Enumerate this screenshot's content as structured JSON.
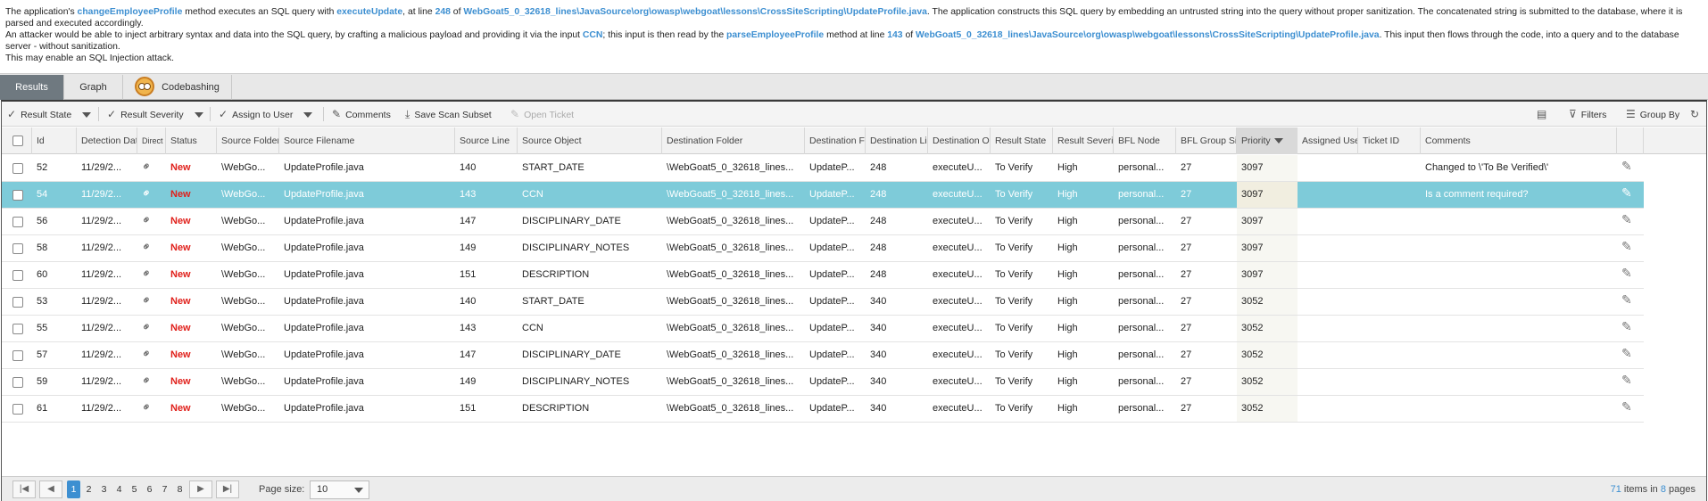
{
  "description": {
    "l1_a": "The application's ",
    "l1_b": "changeEmployeeProfile",
    "l1_c": " method executes an SQL query with ",
    "l1_d": "executeUpdate",
    "l1_e": ", at line ",
    "l1_f": "248",
    "l1_g": " of ",
    "l1_h": "WebGoat5_0_32618_lines\\JavaSource\\org\\owasp\\webgoat\\lessons\\CrossSiteScripting\\UpdateProfile.java",
    "l1_i": ". The application constructs this SQL query by embedding an untrusted string into the query without proper sanitization. The concatenated string is submitted to the database, where it is parsed and executed accordingly.",
    "l2_a": "An attacker would be able to inject arbitrary syntax and data into the SQL query, by crafting a malicious payload and providing it via the input ",
    "l2_b": "CCN",
    "l2_c": "; this input is then read by the ",
    "l2_d": "parseEmployeeProfile",
    "l2_e": " method at line ",
    "l2_f": "143",
    "l2_g": " of ",
    "l2_h": "WebGoat5_0_32618_lines\\JavaSource\\org\\owasp\\webgoat\\lessons\\CrossSiteScripting\\UpdateProfile.java",
    "l2_i": ". This input then flows through the code, into a query and to the database server - without sanitization.",
    "l3": "This may enable an SQL Injection attack."
  },
  "tabs": [
    {
      "label": "Results",
      "active": true
    },
    {
      "label": "Graph",
      "active": false
    },
    {
      "label": "Codebashing",
      "active": false
    }
  ],
  "toolbar": {
    "result_state": "Result State",
    "result_severity": "Result Severity",
    "assign_to_user": "Assign to User",
    "comments": "Comments",
    "save_scan_subset": "Save Scan Subset",
    "open_ticket": "Open Ticket",
    "filters": "Filters",
    "group_by": "Group By"
  },
  "columns": [
    "Id",
    "Detection Date",
    "Direct",
    "Status",
    "Source Folder",
    "Source Filename",
    "Source Line",
    "Source Object",
    "Destination Folder",
    "Destination Fi",
    "Destination Li",
    "Destination Ob",
    "Result State",
    "Result Severity",
    "BFL Node",
    "BFL Group Siz",
    "Priority",
    "Assigned User",
    "Ticket ID",
    "Comments"
  ],
  "rows": [
    {
      "id": "52",
      "date": "11/29/2...",
      "status": "New",
      "src_folder": "\\WebGo...",
      "src_file": "UpdateProfile.java",
      "src_line": "140",
      "src_obj": "START_DATE",
      "dst_folder": "\\WebGoat5_0_32618_lines...",
      "dst_file": "UpdateP...",
      "dst_line": "248",
      "dst_obj": "executeU...",
      "res_state": "To Verify",
      "severity": "High",
      "bfl_node": "personal...",
      "bfl_group": "27",
      "priority": "3097",
      "comment": "Changed to \\'To Be Verified\\'"
    },
    {
      "id": "54",
      "date": "11/29/2...",
      "status": "New",
      "src_folder": "\\WebGo...",
      "src_file": "UpdateProfile.java",
      "src_line": "143",
      "src_obj": "CCN",
      "dst_folder": "\\WebGoat5_0_32618_lines...",
      "dst_file": "UpdateP...",
      "dst_line": "248",
      "dst_obj": "executeU...",
      "res_state": "To Verify",
      "severity": "High",
      "bfl_node": "personal...",
      "bfl_group": "27",
      "priority": "3097",
      "comment": "Is a comment required?"
    },
    {
      "id": "56",
      "date": "11/29/2...",
      "status": "New",
      "src_folder": "\\WebGo...",
      "src_file": "UpdateProfile.java",
      "src_line": "147",
      "src_obj": "DISCIPLINARY_DATE",
      "dst_folder": "\\WebGoat5_0_32618_lines...",
      "dst_file": "UpdateP...",
      "dst_line": "248",
      "dst_obj": "executeU...",
      "res_state": "To Verify",
      "severity": "High",
      "bfl_node": "personal...",
      "bfl_group": "27",
      "priority": "3097",
      "comment": ""
    },
    {
      "id": "58",
      "date": "11/29/2...",
      "status": "New",
      "src_folder": "\\WebGo...",
      "src_file": "UpdateProfile.java",
      "src_line": "149",
      "src_obj": "DISCIPLINARY_NOTES",
      "dst_folder": "\\WebGoat5_0_32618_lines...",
      "dst_file": "UpdateP...",
      "dst_line": "248",
      "dst_obj": "executeU...",
      "res_state": "To Verify",
      "severity": "High",
      "bfl_node": "personal...",
      "bfl_group": "27",
      "priority": "3097",
      "comment": ""
    },
    {
      "id": "60",
      "date": "11/29/2...",
      "status": "New",
      "src_folder": "\\WebGo...",
      "src_file": "UpdateProfile.java",
      "src_line": "151",
      "src_obj": "DESCRIPTION",
      "dst_folder": "\\WebGoat5_0_32618_lines...",
      "dst_file": "UpdateP...",
      "dst_line": "248",
      "dst_obj": "executeU...",
      "res_state": "To Verify",
      "severity": "High",
      "bfl_node": "personal...",
      "bfl_group": "27",
      "priority": "3097",
      "comment": ""
    },
    {
      "id": "53",
      "date": "11/29/2...",
      "status": "New",
      "src_folder": "\\WebGo...",
      "src_file": "UpdateProfile.java",
      "src_line": "140",
      "src_obj": "START_DATE",
      "dst_folder": "\\WebGoat5_0_32618_lines...",
      "dst_file": "UpdateP...",
      "dst_line": "340",
      "dst_obj": "executeU...",
      "res_state": "To Verify",
      "severity": "High",
      "bfl_node": "personal...",
      "bfl_group": "27",
      "priority": "3052",
      "comment": ""
    },
    {
      "id": "55",
      "date": "11/29/2...",
      "status": "New",
      "src_folder": "\\WebGo...",
      "src_file": "UpdateProfile.java",
      "src_line": "143",
      "src_obj": "CCN",
      "dst_folder": "\\WebGoat5_0_32618_lines...",
      "dst_file": "UpdateP...",
      "dst_line": "340",
      "dst_obj": "executeU...",
      "res_state": "To Verify",
      "severity": "High",
      "bfl_node": "personal...",
      "bfl_group": "27",
      "priority": "3052",
      "comment": ""
    },
    {
      "id": "57",
      "date": "11/29/2...",
      "status": "New",
      "src_folder": "\\WebGo...",
      "src_file": "UpdateProfile.java",
      "src_line": "147",
      "src_obj": "DISCIPLINARY_DATE",
      "dst_folder": "\\WebGoat5_0_32618_lines...",
      "dst_file": "UpdateP...",
      "dst_line": "340",
      "dst_obj": "executeU...",
      "res_state": "To Verify",
      "severity": "High",
      "bfl_node": "personal...",
      "bfl_group": "27",
      "priority": "3052",
      "comment": ""
    },
    {
      "id": "59",
      "date": "11/29/2...",
      "status": "New",
      "src_folder": "\\WebGo...",
      "src_file": "UpdateProfile.java",
      "src_line": "149",
      "src_obj": "DISCIPLINARY_NOTES",
      "dst_folder": "\\WebGoat5_0_32618_lines...",
      "dst_file": "UpdateP...",
      "dst_line": "340",
      "dst_obj": "executeU...",
      "res_state": "To Verify",
      "severity": "High",
      "bfl_node": "personal...",
      "bfl_group": "27",
      "priority": "3052",
      "comment": ""
    },
    {
      "id": "61",
      "date": "11/29/2...",
      "status": "New",
      "src_folder": "\\WebGo...",
      "src_file": "UpdateProfile.java",
      "src_line": "151",
      "src_obj": "DESCRIPTION",
      "dst_folder": "\\WebGoat5_0_32618_lines...",
      "dst_file": "UpdateP...",
      "dst_line": "340",
      "dst_obj": "executeU...",
      "res_state": "To Verify",
      "severity": "High",
      "bfl_node": "personal...",
      "bfl_group": "27",
      "priority": "3052",
      "comment": ""
    }
  ],
  "selected_row_index": 1,
  "pager": {
    "pages": [
      "1",
      "2",
      "3",
      "4",
      "5",
      "6",
      "7",
      "8"
    ],
    "current": "1",
    "page_size_label": "Page size:",
    "page_size": "10",
    "total_items": "71",
    "items_in": " items in ",
    "total_pages": "8",
    "pages_word": " pages"
  },
  "colors": {
    "link": "#3d8fd1",
    "new_status": "#e0201b",
    "selected_row": "#7ecbd9",
    "active_tab": "#6f7980"
  }
}
